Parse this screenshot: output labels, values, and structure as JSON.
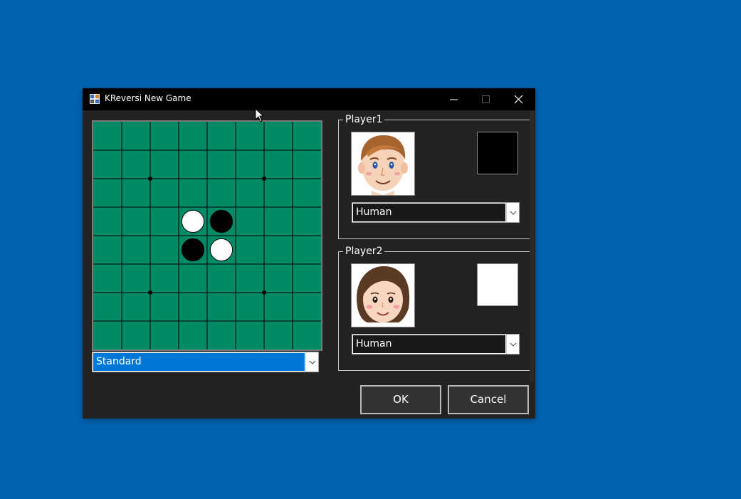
{
  "window": {
    "title": "KReversi New Game"
  },
  "board": {
    "size": 8,
    "pieces": [
      {
        "row": 3,
        "col": 3,
        "color": "white"
      },
      {
        "row": 3,
        "col": 4,
        "color": "black"
      },
      {
        "row": 4,
        "col": 3,
        "color": "black"
      },
      {
        "row": 4,
        "col": 4,
        "color": "white"
      }
    ],
    "star_points": [
      [
        2,
        2
      ],
      [
        2,
        6
      ],
      [
        6,
        2
      ],
      [
        6,
        6
      ]
    ],
    "board_color": "#008a66",
    "layout_select": "Standard"
  },
  "player1": {
    "label": "Player1",
    "avatar": "man-face-avatar",
    "piece_color": "#000000",
    "type": "Human"
  },
  "player2": {
    "label": "Player2",
    "avatar": "woman-face-avatar",
    "piece_color": "#ffffff",
    "type": "Human"
  },
  "buttons": {
    "ok": "OK",
    "cancel": "Cancel"
  },
  "colors": {
    "desktop": "#0063b1",
    "window_bg": "#222222",
    "titlebar": "#000000",
    "selection": "#0078d7"
  }
}
